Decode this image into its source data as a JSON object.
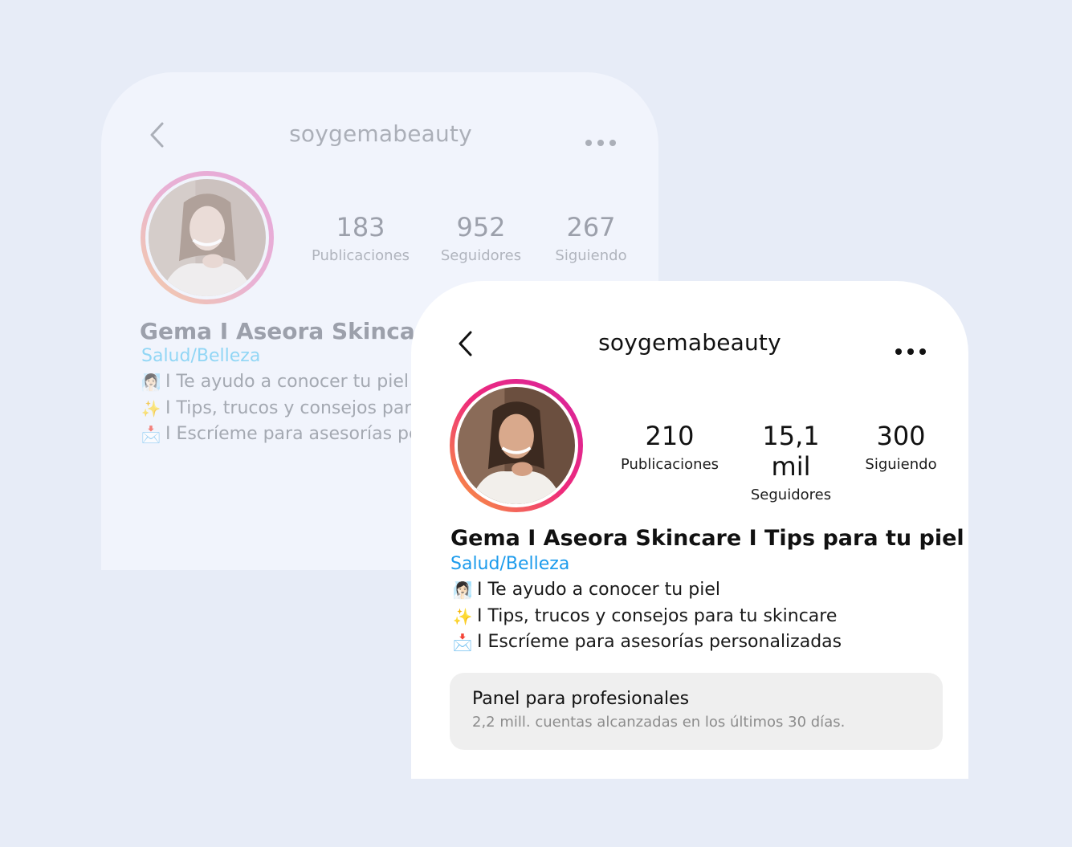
{
  "back_profile": {
    "username": "soygemabeauty",
    "stats": [
      {
        "value": "183",
        "label": "Publicaciones"
      },
      {
        "value": "952",
        "label": "Seguidores"
      },
      {
        "value": "267",
        "label": "Siguiendo"
      }
    ],
    "name": "Gema I Aseora Skincare",
    "category": "Salud/Belleza",
    "bio": [
      {
        "emoji": "🧖🏻‍♀️",
        "text": "I Te ayudo a conocer tu piel"
      },
      {
        "emoji": "✨",
        "text": "I Tips, trucos y consejos para"
      },
      {
        "emoji": "📩",
        "text": "I Escríeme para asesorías per"
      }
    ]
  },
  "front_profile": {
    "username": "soygemabeauty",
    "stats": [
      {
        "value": "210",
        "label": "Publicaciones"
      },
      {
        "value": "15,1 mil",
        "label": "Seguidores"
      },
      {
        "value": "300",
        "label": "Siguiendo"
      }
    ],
    "name": "Gema I Aseora Skincare I Tips para tu piel",
    "category": "Salud/Belleza",
    "bio": [
      {
        "emoji": "🧖🏻‍♀️",
        "text": "I Te ayudo a conocer tu piel"
      },
      {
        "emoji": "✨",
        "text": "I Tips, trucos y consejos para tu skincare"
      },
      {
        "emoji": "📩",
        "text": "I Escríeme para asesorías personalizadas"
      }
    ],
    "panel": {
      "title": "Panel para profesionales",
      "subtitle": "2,2 mill. cuentas alcanzadas en los últimos 30 días."
    }
  },
  "icons": {
    "back": "chevron-left-icon",
    "more": "more-horizontal-icon"
  },
  "colors": {
    "page_bg": "#e7ecf7",
    "back_card_bg": "#f1f4fc",
    "front_card_bg": "#ffffff",
    "category_blue": "#1c9bec",
    "story_ring_start": "#f9a13a",
    "story_ring_end": "#d6249f"
  }
}
